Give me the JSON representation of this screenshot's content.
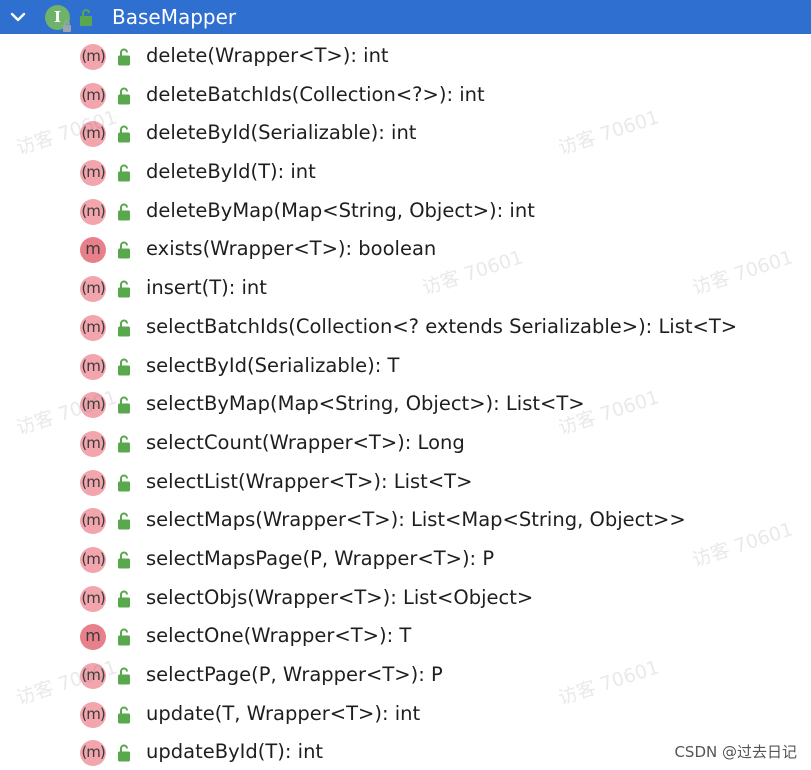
{
  "header": {
    "title": "BaseMapper",
    "interface_glyph": "I",
    "icons": [
      "chevron-down-icon",
      "interface-icon",
      "lock-icon"
    ]
  },
  "methods": [
    {
      "signature": "delete(Wrapper<T>): int",
      "icon": "method-icon",
      "solid": false
    },
    {
      "signature": "deleteBatchIds(Collection<?>): int",
      "icon": "method-icon",
      "solid": false
    },
    {
      "signature": "deleteById(Serializable): int",
      "icon": "method-icon",
      "solid": false
    },
    {
      "signature": "deleteById(T): int",
      "icon": "method-icon",
      "solid": false
    },
    {
      "signature": "deleteByMap(Map<String, Object>): int",
      "icon": "method-icon",
      "solid": false
    },
    {
      "signature": "exists(Wrapper<T>): boolean",
      "icon": "method-icon",
      "solid": true
    },
    {
      "signature": "insert(T): int",
      "icon": "method-icon",
      "solid": false
    },
    {
      "signature": "selectBatchIds(Collection<? extends Serializable>): List<T>",
      "icon": "method-icon",
      "solid": false
    },
    {
      "signature": "selectById(Serializable): T",
      "icon": "method-icon",
      "solid": false
    },
    {
      "signature": "selectByMap(Map<String, Object>): List<T>",
      "icon": "method-icon",
      "solid": false
    },
    {
      "signature": "selectCount(Wrapper<T>): Long",
      "icon": "method-icon",
      "solid": false
    },
    {
      "signature": "selectList(Wrapper<T>): List<T>",
      "icon": "method-icon",
      "solid": false
    },
    {
      "signature": "selectMaps(Wrapper<T>): List<Map<String, Object>>",
      "icon": "method-icon",
      "solid": false
    },
    {
      "signature": "selectMapsPage(P, Wrapper<T>): P",
      "icon": "method-icon",
      "solid": false
    },
    {
      "signature": "selectObjs(Wrapper<T>): List<Object>",
      "icon": "method-icon",
      "solid": false
    },
    {
      "signature": "selectOne(Wrapper<T>): T",
      "icon": "method-icon",
      "solid": true
    },
    {
      "signature": "selectPage(P, Wrapper<T>): P",
      "icon": "method-icon",
      "solid": false
    },
    {
      "signature": "update(T, Wrapper<T>): int",
      "icon": "method-icon",
      "solid": false
    },
    {
      "signature": "updateById(T): int",
      "icon": "method-icon",
      "solid": false
    }
  ],
  "method_glyph": "m",
  "watermark_text": "访客 70601",
  "footer_credit": "CSDN @过去日记",
  "colors": {
    "header_bg": "#2f6fd0",
    "method_icon": "#f2a5ad",
    "method_icon_solid": "#e8808c",
    "lock": "#5aa84e",
    "interface_icon": "#6fb36a"
  }
}
